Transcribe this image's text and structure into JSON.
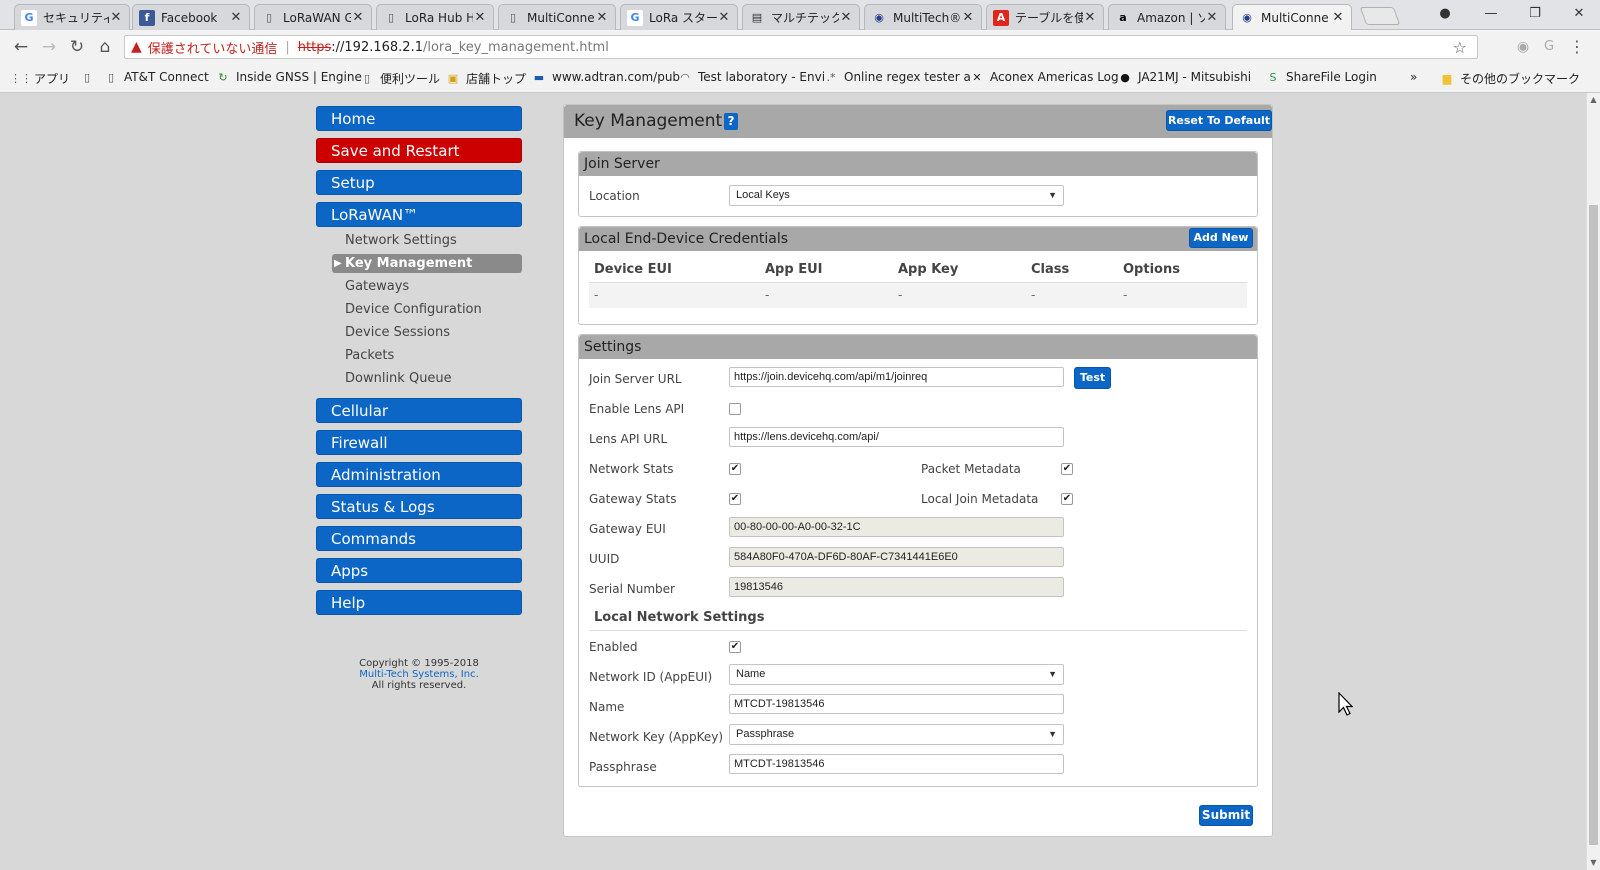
{
  "browser": {
    "tabs": [
      {
        "label": "セキュリティ診",
        "icon": "google-icon"
      },
      {
        "label": "Facebook",
        "icon": "facebook-icon"
      },
      {
        "label": "LoRaWAN G",
        "icon": "page-icon"
      },
      {
        "label": "LoRa Hub H",
        "icon": "page-icon"
      },
      {
        "label": "MultiConne",
        "icon": "page-icon"
      },
      {
        "label": "LoRa スターター",
        "icon": "google-icon"
      },
      {
        "label": "マルチテック L",
        "icon": "site-icon"
      },
      {
        "label": "MultiTech®",
        "icon": "multitech-icon"
      },
      {
        "label": "テーブルを使用",
        "icon": "adobe-icon"
      },
      {
        "label": "Amazon | ソ",
        "icon": "amazon-icon"
      },
      {
        "label": "MultiConne",
        "icon": "multitech-icon"
      }
    ],
    "active_tab": 10,
    "address": {
      "warning": "保護されていない通信",
      "scheme": "https",
      "host": "://192.168.2.1",
      "path": "/lora_key_management.html"
    },
    "bookmarks": [
      {
        "label": "アプリ",
        "icon": "apps-grid-icon"
      },
      {
        "label": "",
        "icon": "page-icon"
      },
      {
        "label": "AT&T Connect",
        "icon": "page-icon"
      },
      {
        "label": "Inside GNSS | Engine",
        "icon": "gnss-icon"
      },
      {
        "label": "便利ツール",
        "icon": "page-icon"
      },
      {
        "label": "店舗トップ",
        "icon": "store-icon"
      },
      {
        "label": "www.adtran.com/pub",
        "icon": "adtran-icon"
      },
      {
        "label": "Test laboratory - Envi",
        "icon": "wifi-icon"
      },
      {
        "label": "Online regex tester a",
        "icon": "regex-icon"
      },
      {
        "label": "Aconex Americas Log",
        "icon": "aconex-icon"
      },
      {
        "label": "JA21MJ - Mitsubishi",
        "icon": "github-icon"
      },
      {
        "label": "ShareFile Login",
        "icon": "sharefile-icon"
      },
      {
        "label": "»",
        "icon": ""
      },
      {
        "label": "その他のブックマーク",
        "icon": "folder-icon"
      }
    ]
  },
  "sidebar": {
    "main": [
      {
        "label": "Home",
        "color": "#0c66c6"
      },
      {
        "label": "Save and Restart",
        "color": "#cc0000"
      },
      {
        "label": "Setup",
        "color": "#0c66c6"
      },
      {
        "label": "LoRaWAN™",
        "color": "#0c66c6"
      }
    ],
    "lorawan_sub": [
      {
        "label": "Network Settings",
        "active": false
      },
      {
        "label": "Key Management",
        "active": true
      },
      {
        "label": "Gateways",
        "active": false
      },
      {
        "label": "Device Configuration",
        "active": false
      },
      {
        "label": "Device Sessions",
        "active": false
      },
      {
        "label": "Packets",
        "active": false
      },
      {
        "label": "Downlink Queue",
        "active": false
      }
    ],
    "main_after": [
      {
        "label": "Cellular"
      },
      {
        "label": "Firewall"
      },
      {
        "label": "Administration"
      },
      {
        "label": "Status & Logs"
      },
      {
        "label": "Commands"
      },
      {
        "label": "Apps"
      },
      {
        "label": "Help"
      }
    ],
    "copyright": {
      "line1": "Copyright © 1995-2018",
      "company": "Multi-Tech Systems, Inc.",
      "line3": "All rights reserved."
    }
  },
  "page": {
    "title": "Key Management",
    "help": "?",
    "reset_label": "Reset To Default",
    "join_server": {
      "title": "Join Server",
      "location_label": "Location",
      "location_value": "Local Keys"
    },
    "credentials": {
      "title": "Local End-Device Credentials",
      "add_new_label": "Add New",
      "columns": [
        "Device EUI",
        "App EUI",
        "App Key",
        "Class",
        "Options"
      ],
      "rows": [
        [
          "-",
          "-",
          "-",
          "-",
          "-"
        ]
      ]
    },
    "settings": {
      "title": "Settings",
      "join_server_url_label": "Join Server URL",
      "join_server_url": "https://join.devicehq.com/api/m1/joinreq",
      "test_label": "Test",
      "enable_lens_label": "Enable Lens API",
      "enable_lens": false,
      "lens_url_label": "Lens API URL",
      "lens_url": "https://lens.devicehq.com/api/",
      "network_stats_label": "Network Stats",
      "network_stats": true,
      "packet_metadata_label": "Packet Metadata",
      "packet_metadata": true,
      "gateway_stats_label": "Gateway Stats",
      "gateway_stats": true,
      "local_join_metadata_label": "Local Join Metadata",
      "local_join_metadata": true,
      "gateway_eui_label": "Gateway EUI",
      "gateway_eui": "00-80-00-00-A0-00-32-1C",
      "uuid_label": "UUID",
      "uuid": "584A80F0-470A-DF6D-80AF-C7341441E6E0",
      "serial_label": "Serial Number",
      "serial": "19813546",
      "lns_title": "Local Network Settings",
      "enabled_label": "Enabled",
      "enabled": true,
      "network_id_label": "Network ID (AppEUI)",
      "network_id_value": "Name",
      "name_label": "Name",
      "name_value": "MTCDT-19813546",
      "network_key_label": "Network Key (AppKey)",
      "network_key_value": "Passphrase",
      "passphrase_label": "Passphrase",
      "passphrase_value": "MTCDT-19813546"
    },
    "submit_label": "Submit"
  }
}
